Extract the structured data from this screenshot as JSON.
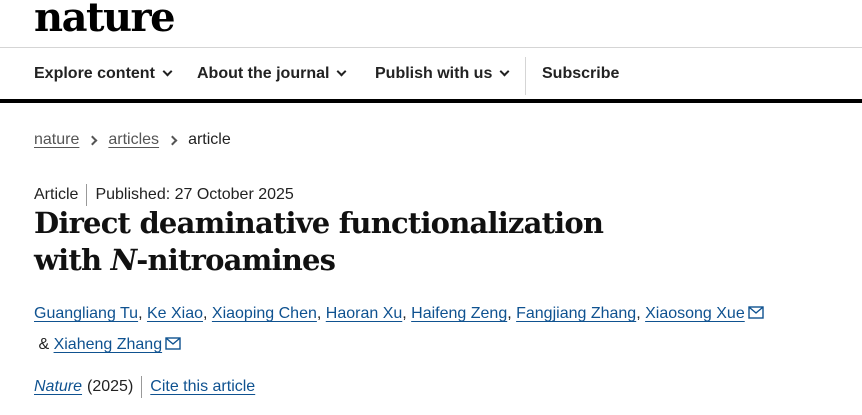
{
  "header": {
    "logo": "nature"
  },
  "nav": {
    "items": [
      {
        "label": "Explore content",
        "has_dropdown": true
      },
      {
        "label": "About the journal",
        "has_dropdown": true
      },
      {
        "label": "Publish with us",
        "has_dropdown": true
      },
      {
        "label": "Subscribe",
        "has_dropdown": false
      }
    ]
  },
  "breadcrumb": {
    "items": [
      "nature",
      "articles",
      "article"
    ]
  },
  "article": {
    "type": "Article",
    "published": "Published: 27 October 2025",
    "title_part1": "Direct deaminative functionalization with ",
    "title_italic": "N",
    "title_part2": "-nitroamines",
    "authors": [
      {
        "name": "Guangliang Tu",
        "after": ", ",
        "email_icon": false
      },
      {
        "name": "Ke Xiao",
        "after": ", ",
        "email_icon": false
      },
      {
        "name": "Xiaoping Chen",
        "after": ", ",
        "email_icon": false
      },
      {
        "name": "Haoran Xu",
        "after": ", ",
        "email_icon": false
      },
      {
        "name": "Haifeng Zeng",
        "after": ", ",
        "email_icon": false
      },
      {
        "name": "Fangjiang Zhang",
        "after": ", ",
        "email_icon": false
      },
      {
        "name": "Xiaosong Xue",
        "after": " & ",
        "email_icon": true
      },
      {
        "name": "Xiaheng Zhang",
        "after": "",
        "email_icon": true
      }
    ],
    "journal": "Nature",
    "year": "(2025)",
    "cite_label": "Cite this article"
  },
  "colors": {
    "link": "#0f5290",
    "text": "#222222"
  },
  "icons": {
    "dropdown": "chevron-down-icon",
    "breadcrumb_separator": "chevron-right-icon",
    "author_contact": "mail-icon"
  }
}
